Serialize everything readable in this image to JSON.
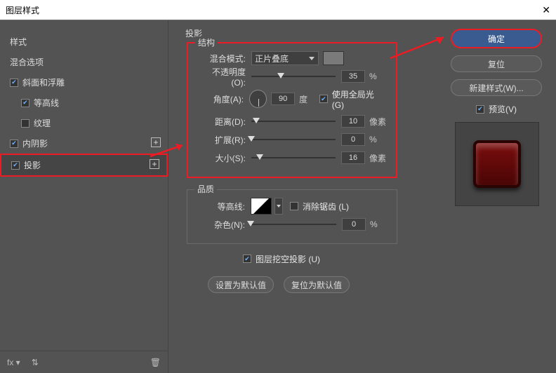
{
  "title": "图层样式",
  "sidebar": {
    "header": "样式",
    "blend_options": "混合选项",
    "items": [
      {
        "label": "斜面和浮雕",
        "checked": true,
        "sub": false,
        "add": false
      },
      {
        "label": "等高线",
        "checked": true,
        "sub": true,
        "add": false
      },
      {
        "label": "纹理",
        "checked": false,
        "sub": true,
        "add": false
      },
      {
        "label": "内阴影",
        "checked": true,
        "sub": false,
        "add": true
      },
      {
        "label": "投影",
        "checked": true,
        "sub": false,
        "add": true
      }
    ],
    "footer_fx": "fx"
  },
  "panel": {
    "title": "投影",
    "struct_title": "结构",
    "blend_mode_label": "混合模式:",
    "blend_mode_value": "正片叠底",
    "opacity_label": "不透明度(O):",
    "opacity_value": "35",
    "percent": "%",
    "angle_label": "角度(A):",
    "angle_value": "90",
    "angle_unit": "度",
    "global_light_label": "使用全局光 (G)",
    "global_light_checked": true,
    "distance_label": "距离(D):",
    "distance_value": "10",
    "px": "像素",
    "spread_label": "扩展(R):",
    "spread_value": "0",
    "size_label": "大小(S):",
    "size_value": "16",
    "quality_title": "品质",
    "contour_label": "等高线:",
    "antialias_label": "消除锯齿 (L)",
    "antialias_checked": false,
    "noise_label": "杂色(N):",
    "noise_value": "0",
    "knockout_label": "图层挖空投影 (U)",
    "knockout_checked": true,
    "set_default": "设置为默认值",
    "reset_default": "复位为默认值"
  },
  "right": {
    "ok": "确定",
    "cancel": "复位",
    "new_style": "新建样式(W)...",
    "preview_label": "预览(V)",
    "preview_checked": true
  }
}
